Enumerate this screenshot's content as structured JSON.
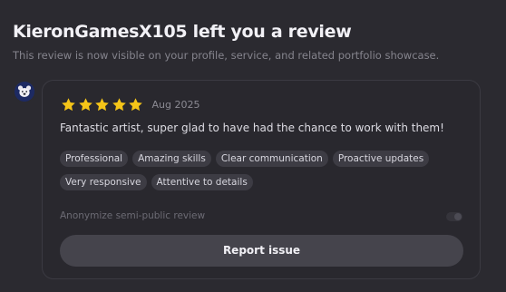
{
  "header": {
    "title": "KieronGamesX105 left you a review",
    "subtitle": "This review is now visible on your profile, service, and related portfolio showcase."
  },
  "reviewer": {
    "avatar_icon": "bear-mascot-avatar"
  },
  "review": {
    "rating": 5,
    "rating_max": 5,
    "star_color": "#f5c518",
    "date": "Aug 2025",
    "text": "Fantastic artist, super glad to have had the chance to work with them!",
    "tags": [
      "Professional",
      "Amazing skills",
      "Clear communication",
      "Proactive updates",
      "Very responsive",
      "Attentive to details"
    ]
  },
  "anonymize": {
    "label": "Anonymize semi-public review",
    "enabled": false
  },
  "actions": {
    "report_label": "Report issue"
  }
}
